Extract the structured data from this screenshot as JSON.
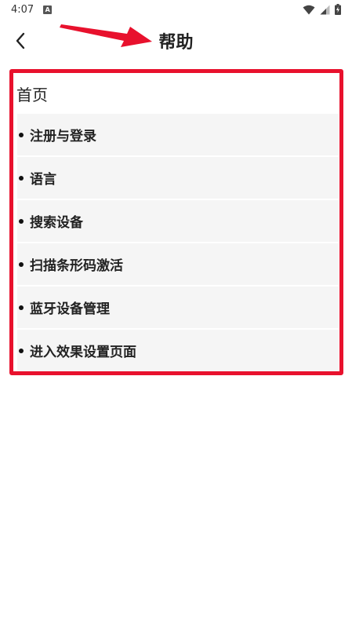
{
  "status_bar": {
    "time": "4:07",
    "notification_badge": "A",
    "icons": [
      "wifi-icon",
      "cell-signal-icon",
      "battery-charging-icon"
    ]
  },
  "header": {
    "title": "帮助",
    "back_icon": "chevron-left-icon"
  },
  "annotation": {
    "arrow_color": "#e8112d",
    "box_color": "#e8112d"
  },
  "section": {
    "title": "首页",
    "items": [
      {
        "label": "注册与登录"
      },
      {
        "label": "语言"
      },
      {
        "label": "搜索设备"
      },
      {
        "label": "扫描条形码激活"
      },
      {
        "label": "蓝牙设备管理"
      },
      {
        "label": "进入效果设置页面"
      }
    ]
  }
}
